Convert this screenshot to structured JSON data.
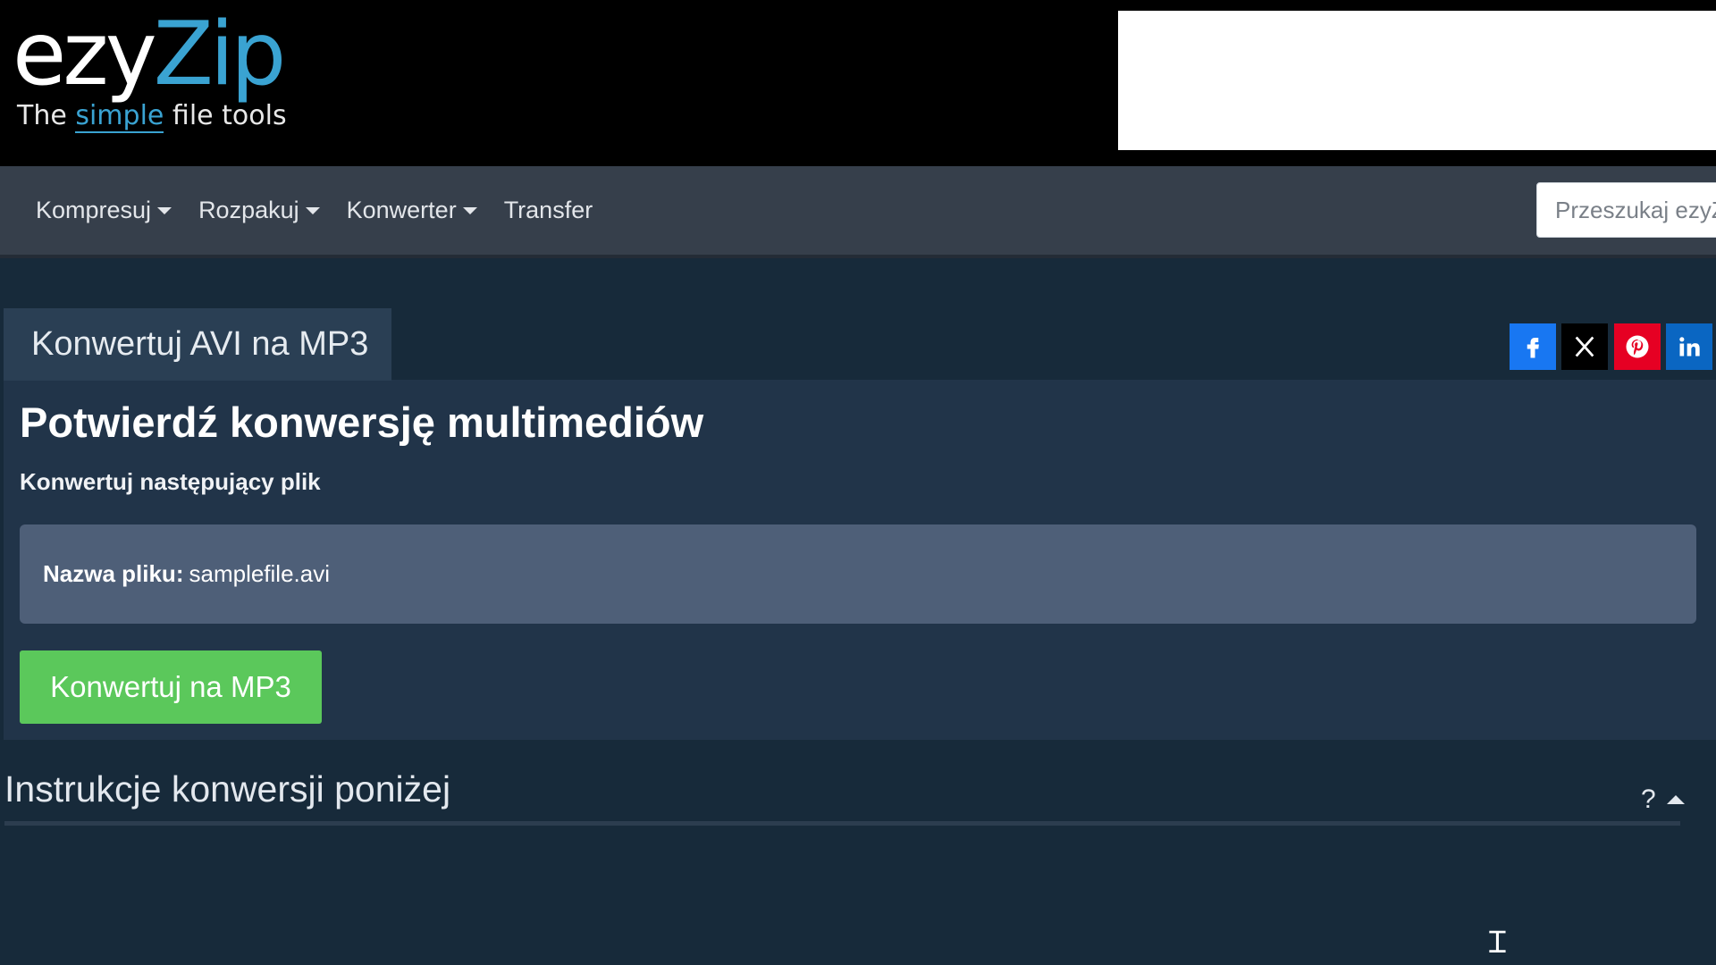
{
  "logo": {
    "part1": "ezy",
    "part2": "Zip",
    "tagline_pre": "The",
    "tagline_hl": "simple",
    "tagline_post": "file tools"
  },
  "nav": {
    "items": [
      {
        "label": "Kompresuj",
        "dropdown": true
      },
      {
        "label": "Rozpakuj",
        "dropdown": true
      },
      {
        "label": "Konwerter",
        "dropdown": true
      },
      {
        "label": "Transfer",
        "dropdown": false
      }
    ],
    "search_placeholder": "Przeszukaj ezyZip"
  },
  "tab_title": "Konwertuj AVI na MP3",
  "social": [
    "facebook-icon",
    "x-icon",
    "pinterest-icon",
    "linkedin-icon"
  ],
  "main": {
    "heading": "Potwierdź konwersję multimediów",
    "subtitle": "Konwertuj następujący plik",
    "file_label": "Nazwa pliku:",
    "file_name": "samplefile.avi",
    "convert_button": "Konwertuj na MP3"
  },
  "instructions": {
    "title": "Instrukcje konwersji poniżej",
    "help": "?"
  },
  "colors": {
    "accent": "#3aa3d2",
    "button": "#5bc85b",
    "background": "#172a3a",
    "nav": "#363f4b"
  }
}
